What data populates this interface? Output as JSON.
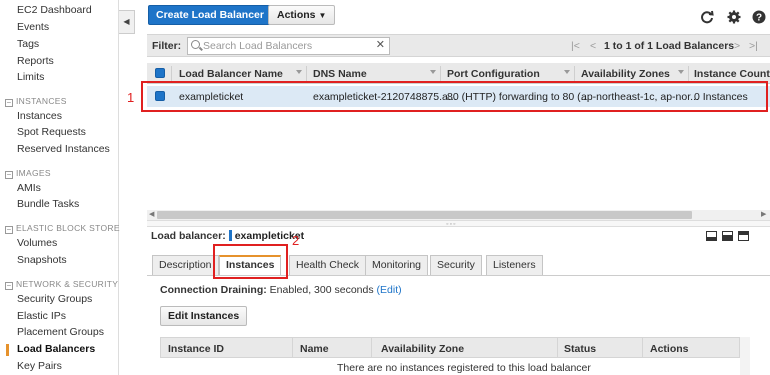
{
  "sidebar": {
    "top_links": [
      "EC2 Dashboard",
      "Events",
      "Tags",
      "Reports",
      "Limits"
    ],
    "sections": [
      {
        "title": "INSTANCES",
        "items": [
          "Instances",
          "Spot Requests",
          "Reserved Instances"
        ]
      },
      {
        "title": "IMAGES",
        "items": [
          "AMIs",
          "Bundle Tasks"
        ]
      },
      {
        "title": "ELASTIC BLOCK STORE",
        "items": [
          "Volumes",
          "Snapshots"
        ]
      },
      {
        "title": "NETWORK & SECURITY",
        "items": [
          "Security Groups",
          "Elastic IPs",
          "Placement Groups",
          "Load Balancers",
          "Key Pairs"
        ]
      }
    ],
    "active_item": "Load Balancers",
    "collapse_glyph": "◀"
  },
  "toolbar": {
    "create_label": "Create Load Balancer",
    "actions_label": "Actions",
    "refresh_icon": "refresh-icon",
    "settings_icon": "gear-icon",
    "help_icon": "help-icon"
  },
  "filter": {
    "label": "Filter:",
    "placeholder": "Search Load Balancers",
    "clear_glyph": "✕",
    "pager_text": "1 to 1 of 1 Load Balancers",
    "first_glyph": "|<",
    "prev_glyph": "<",
    "next_glyph": ">",
    "last_glyph": ">|"
  },
  "table": {
    "columns": [
      "Load Balancer Name",
      "DNS Name",
      "Port Configuration",
      "Availability Zones",
      "Instance Count"
    ],
    "rows": [
      {
        "name": "exampleticket",
        "dns": "exampleticket-2120748875.a...",
        "port": "80 (HTTP) forwarding to 80 (...",
        "zones": "ap-northeast-1c, ap-nor...",
        "count": "0 Instances"
      }
    ]
  },
  "annotations": {
    "marker1": "1",
    "marker2": "2",
    "color": "#e02020"
  },
  "details": {
    "title_label": "Load balancer:",
    "lb_name": "exampleticket",
    "splitter_glyph": "◦◦◦",
    "tabs": [
      "Description",
      "Instances",
      "Health Check",
      "Monitoring",
      "Security",
      "Listeners"
    ],
    "active_tab": "Instances",
    "draining_label": "Connection Draining:",
    "draining_value": "Enabled, 300 seconds",
    "edit_link": "(Edit)",
    "edit_button": "Edit Instances",
    "instance_columns": [
      "Instance ID",
      "Name",
      "Availability Zone",
      "Status",
      "Actions"
    ],
    "empty_message": "There are no instances registered to this load balancer"
  },
  "colors": {
    "accent": "#1e74c8",
    "active_tab": "#e6922c",
    "selected_row": "#dce9f5"
  }
}
